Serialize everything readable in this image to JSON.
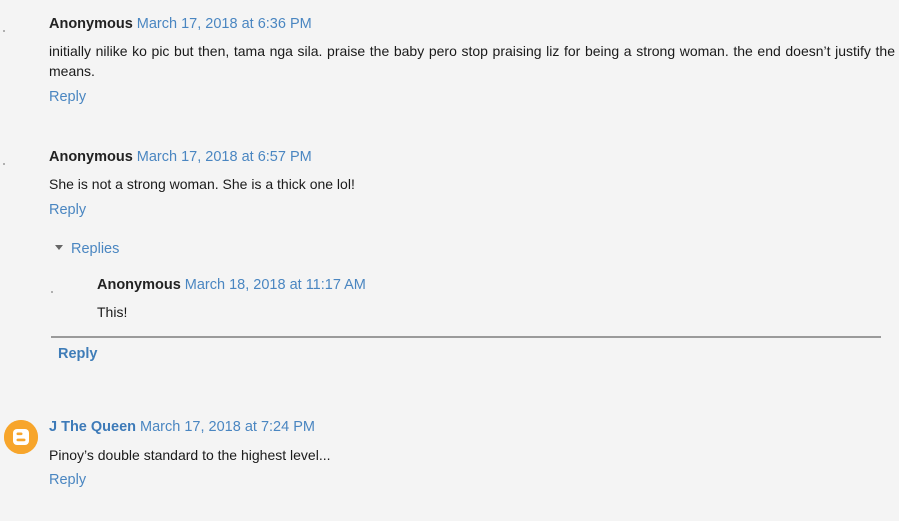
{
  "comments": [
    {
      "author": "Anonymous",
      "date": "March 17, 2018 at 6:36 PM",
      "text": "initially nilike ko pic but then, tama nga sila. praise the baby pero stop praising liz for being a strong woman. the end doesn’t justify the means.",
      "reply_label": "Reply"
    },
    {
      "author": "Anonymous",
      "date": "March 17, 2018 at 6:57 PM",
      "text": "She is not a strong woman. She is a thick one lol!",
      "reply_label": "Reply",
      "replies_label": "Replies",
      "replies": [
        {
          "author": "Anonymous",
          "date": "March 18, 2018 at 11:17 AM",
          "text": "This!"
        }
      ],
      "thread_reply_label": "Reply"
    },
    {
      "author": "J The Queen",
      "date": "March 17, 2018 at 7:24 PM",
      "text": "Pinoy’s double standard to the highest level...",
      "reply_label": "Reply",
      "avatar_icon": "blogger-icon",
      "avatar_color": "#f7a52b"
    }
  ]
}
